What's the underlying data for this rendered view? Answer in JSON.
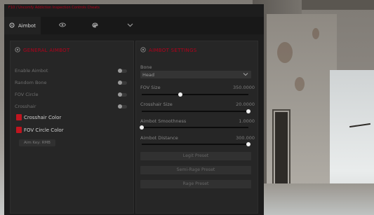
{
  "window": {
    "title": "F10 / Uncomfy Addiction Inspection Controls Cheats",
    "accent_color": "#b3001b"
  },
  "tabs": [
    {
      "label": "Aimbot",
      "icon": "crosshair-icon",
      "active": true
    },
    {
      "label": "",
      "icon": "eye-icon",
      "active": false
    },
    {
      "label": "",
      "icon": "palette-icon",
      "active": false
    },
    {
      "label": "",
      "icon": "chevron-down-icon",
      "active": false
    }
  ],
  "general": {
    "title": "GENERAL AIMBOT",
    "toggles": [
      {
        "label": "Enable Aimbot",
        "on": false
      },
      {
        "label": "Random Bone",
        "on": false
      },
      {
        "label": "FOV Circle",
        "on": false
      },
      {
        "label": "Crosshair",
        "on": false
      }
    ],
    "colors": [
      {
        "label": "Crosshair Color",
        "color": "#c0151f"
      },
      {
        "label": "FOV Circle Color",
        "color": "#c0151f"
      }
    ],
    "aim_key_label": "Aim Key: RMB"
  },
  "settings": {
    "title": "AIMBOT SETTINGS",
    "bone": {
      "label": "Bone",
      "value": "Head"
    },
    "sliders": [
      {
        "label": "FOV Size",
        "value": "350.0000",
        "level": 0.36
      },
      {
        "label": "Crosshair Size",
        "value": "20.0000",
        "level": 1.0
      },
      {
        "label": "Aimbot Smoothness",
        "value": "1.0000",
        "level": 0.0
      },
      {
        "label": "Aimbot Distance",
        "value": "300.000",
        "level": 1.0
      }
    ],
    "presets": [
      "Legit Preset",
      "Semi-Rage Preset",
      "Rage Preset"
    ]
  }
}
